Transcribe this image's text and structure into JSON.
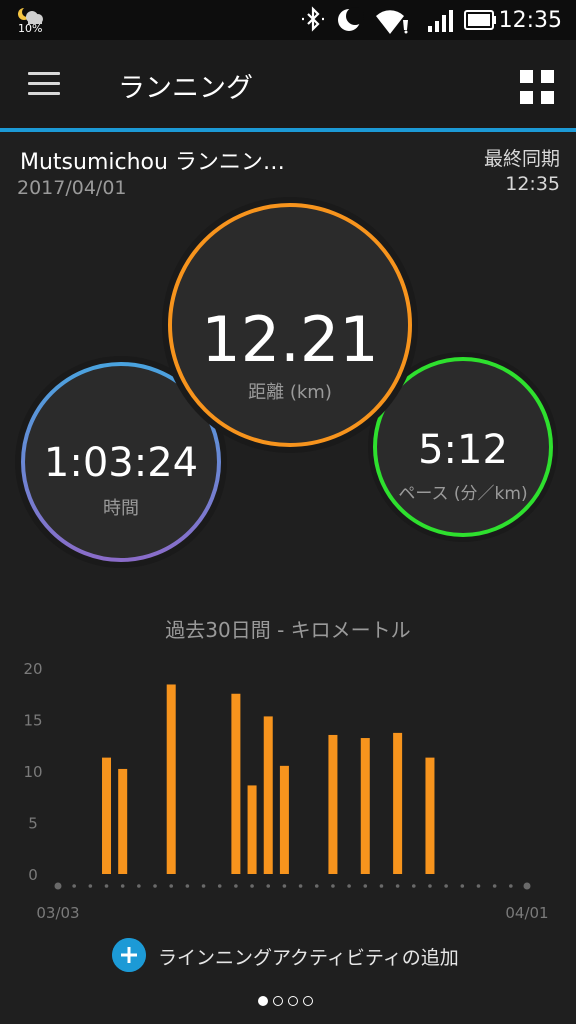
{
  "status_bar": {
    "time": "12:35",
    "battery_percent": "10%",
    "icons": [
      "weather-night-icon",
      "bluetooth-icon",
      "do-not-disturb-moon-icon",
      "wifi-icon",
      "signal-icon",
      "battery-icon"
    ]
  },
  "app_bar": {
    "title": "ランニング",
    "menu_icon": "hamburger-menu-icon",
    "widgets_icon": "grid-icon"
  },
  "activity": {
    "name": "Mutsumichou ランニン…",
    "date": "2017/04/01",
    "sync_label": "最終同期",
    "sync_time": "12:35"
  },
  "metrics": {
    "distance": {
      "value": "12.21",
      "label": "距離 (km)",
      "color": "#f7941d"
    },
    "time": {
      "value": "1:03:24",
      "label": "時間",
      "color_start": "#4aa3df",
      "color_end": "#8a6cc9"
    },
    "pace": {
      "value": "5:12",
      "label": "ペース (分／km)",
      "color": "#2ee02e"
    }
  },
  "chart_title": "過去30日間 - キロメートル",
  "chart_data": {
    "type": "bar",
    "title": "過去30日間 - キロメートル",
    "ylim": [
      0,
      20
    ],
    "yticks": [
      "20",
      "15",
      "10",
      "5",
      "0"
    ],
    "x_start_label": "03/03",
    "x_end_label": "04/01",
    "num_days": 30,
    "bar_color": "#f7941d",
    "bars": [
      {
        "day_index": 3,
        "value": 11.3
      },
      {
        "day_index": 4,
        "value": 10.2
      },
      {
        "day_index": 7,
        "value": 18.4
      },
      {
        "day_index": 11,
        "value": 17.5
      },
      {
        "day_index": 12,
        "value": 8.6
      },
      {
        "day_index": 13,
        "value": 15.3
      },
      {
        "day_index": 14,
        "value": 10.5
      },
      {
        "day_index": 17,
        "value": 13.5
      },
      {
        "day_index": 19,
        "value": 13.2
      },
      {
        "day_index": 21,
        "value": 13.7
      },
      {
        "day_index": 23,
        "value": 11.3
      }
    ]
  },
  "add_activity_label": "ラインニングアクティビティの追加",
  "page_indicator": {
    "count": 4,
    "active": 0
  }
}
